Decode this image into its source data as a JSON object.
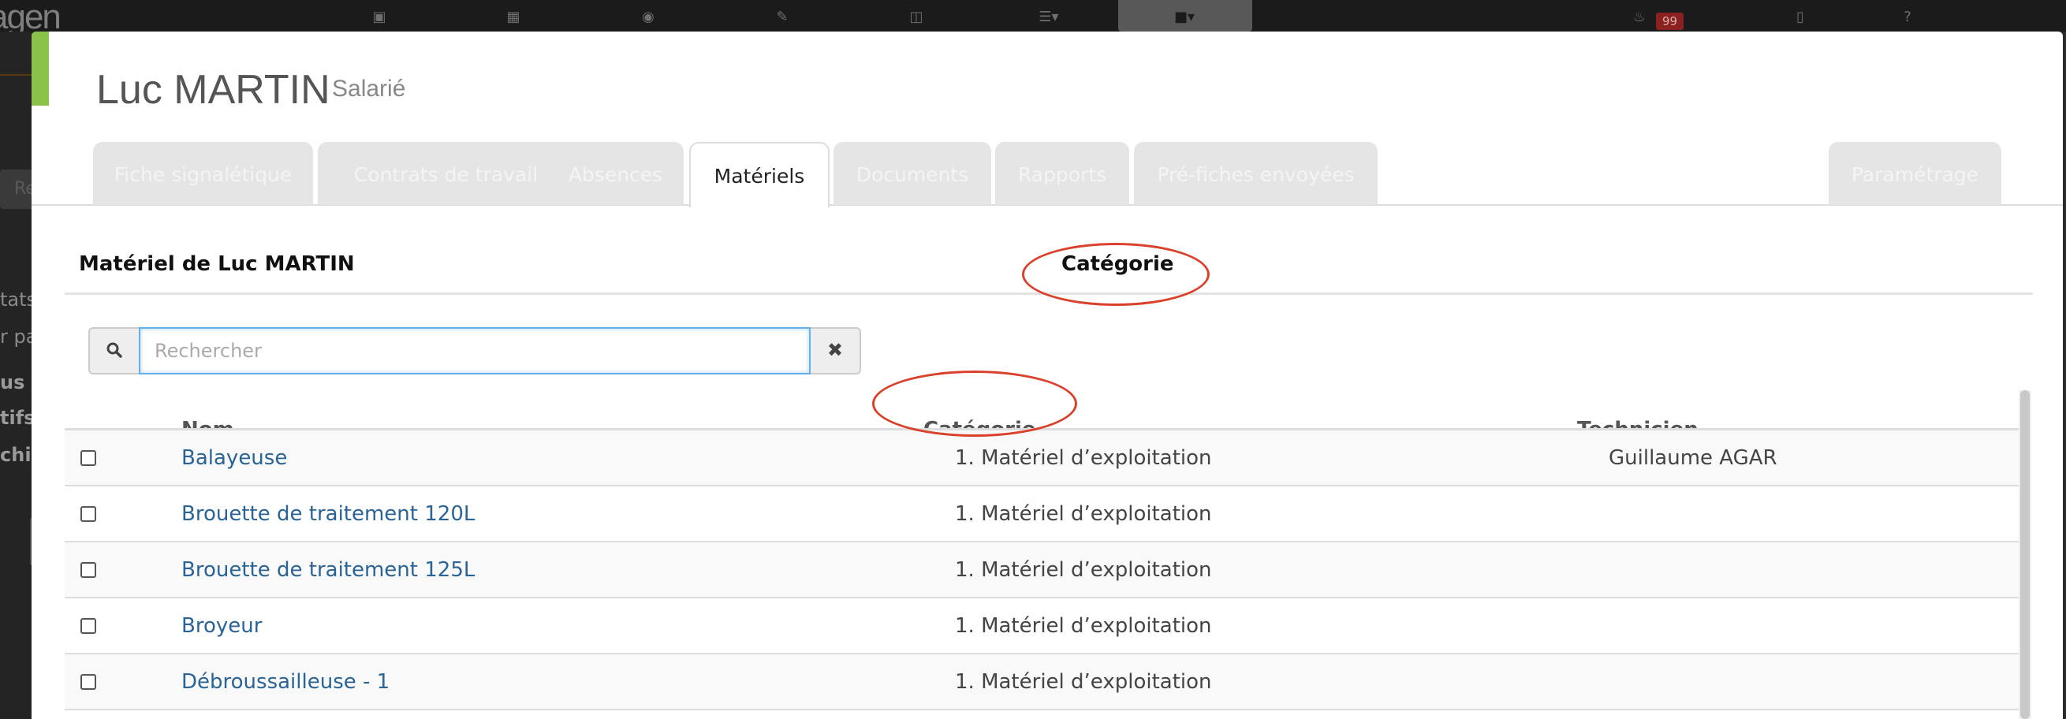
{
  "background": {
    "brand_fragment": "agen",
    "notification_count": "99",
    "search_fragment": "Re",
    "side_texts": [
      {
        "text": "tats",
        "bold": false
      },
      {
        "text": "r pa",
        "bold": false
      },
      {
        "text": "us",
        "bold": true
      },
      {
        "text": "tifs",
        "bold": true
      },
      {
        "text": "chiv",
        "bold": true
      }
    ]
  },
  "header": {
    "name": "Luc MARTIN",
    "role": "Salarié"
  },
  "tabs": [
    {
      "label": "Fiche signalétique",
      "active": false
    },
    {
      "label": "Contrats de travail",
      "active": false
    },
    {
      "label": "Absences",
      "active": false
    },
    {
      "label": "Matériels",
      "active": true
    },
    {
      "label": "Documents",
      "active": false
    },
    {
      "label": "Rapports",
      "active": false
    },
    {
      "label": "Pré-fiches envoyées",
      "active": false
    },
    {
      "label": "Paramétrage",
      "active": false
    }
  ],
  "section": {
    "title": "Matériel de Luc MARTIN",
    "category_label": "Catégorie"
  },
  "search": {
    "placeholder": "Rechercher",
    "value": ""
  },
  "table": {
    "columns": [
      "Nom",
      "Catégorie",
      "Technicien"
    ],
    "rows": [
      {
        "name": "Balayeuse",
        "category": "1. Matériel d’exploitation",
        "technician": "Guillaume AGAR"
      },
      {
        "name": "Brouette de traitement 120L",
        "category": "1. Matériel d’exploitation",
        "technician": ""
      },
      {
        "name": "Brouette de traitement 125L",
        "category": "1. Matériel d’exploitation",
        "technician": ""
      },
      {
        "name": "Broyeur",
        "category": "1. Matériel d’exploitation",
        "technician": ""
      },
      {
        "name": "Débroussailleuse - 1",
        "category": "1. Matériel d’exploitation",
        "technician": ""
      }
    ]
  },
  "colors": {
    "accent_green": "#8bc34a",
    "link_blue": "#2a6496",
    "annotation_red": "#d9412b",
    "notification_red": "#8b2020"
  }
}
